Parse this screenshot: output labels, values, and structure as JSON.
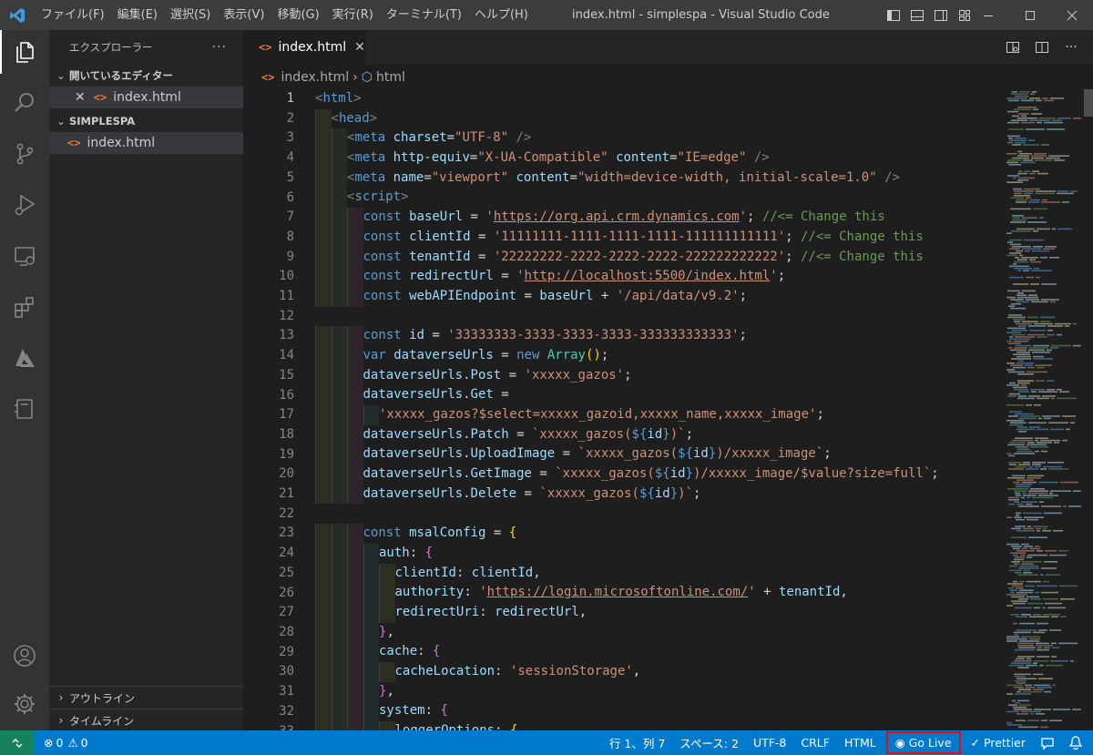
{
  "titlebar": {
    "menus": [
      "ファイル(F)",
      "編集(E)",
      "選択(S)",
      "表示(V)",
      "移動(G)",
      "実行(R)",
      "ターミナル(T)",
      "ヘルプ(H)"
    ],
    "title": "index.html - simplespa - Visual Studio Code"
  },
  "sidebar": {
    "header": "エクスプローラー",
    "more": "···",
    "open_editors_label": "開いているエディター",
    "open_editors": [
      {
        "name": "index.html"
      }
    ],
    "folder_label": "SIMPLESPA",
    "files": [
      {
        "name": "index.html"
      }
    ],
    "outline_label": "アウトライン",
    "timeline_label": "タイムライン"
  },
  "editor": {
    "tab": {
      "label": "index.html"
    },
    "breadcrumb": [
      "index.html",
      "html"
    ],
    "lines": [
      {
        "n": "1",
        "i": "",
        "t": [
          [
            "br",
            "<"
          ],
          [
            "tg",
            "html"
          ],
          [
            "br",
            ">"
          ]
        ]
      },
      {
        "n": "2",
        "i": "y",
        "t": [
          [
            "br",
            "<"
          ],
          [
            "tg",
            "head"
          ],
          [
            "br",
            ">"
          ]
        ]
      },
      {
        "n": "3",
        "i": "yg",
        "t": [
          [
            "br",
            "<"
          ],
          [
            "tg",
            "meta"
          ],
          [
            "pl",
            " "
          ],
          [
            "at",
            "charset"
          ],
          [
            "pl",
            "="
          ],
          [
            "st",
            "\"UTF-8\""
          ],
          [
            "pl",
            " "
          ],
          [
            "br",
            "/>"
          ]
        ]
      },
      {
        "n": "4",
        "i": "yg",
        "t": [
          [
            "br",
            "<"
          ],
          [
            "tg",
            "meta"
          ],
          [
            "pl",
            " "
          ],
          [
            "at",
            "http-equiv"
          ],
          [
            "pl",
            "="
          ],
          [
            "st",
            "\"X-UA-Compatible\""
          ],
          [
            "pl",
            " "
          ],
          [
            "at",
            "content"
          ],
          [
            "pl",
            "="
          ],
          [
            "st",
            "\"IE=edge\""
          ],
          [
            "pl",
            " "
          ],
          [
            "br",
            "/>"
          ]
        ]
      },
      {
        "n": "5",
        "i": "yg",
        "t": [
          [
            "br",
            "<"
          ],
          [
            "tg",
            "meta"
          ],
          [
            "pl",
            " "
          ],
          [
            "at",
            "name"
          ],
          [
            "pl",
            "="
          ],
          [
            "st",
            "\"viewport\""
          ],
          [
            "pl",
            " "
          ],
          [
            "at",
            "content"
          ],
          [
            "pl",
            "="
          ],
          [
            "st",
            "\"width=device-width, initial-scale=1.0\""
          ],
          [
            "pl",
            " "
          ],
          [
            "br",
            "/>"
          ]
        ]
      },
      {
        "n": "6",
        "i": "yg",
        "t": [
          [
            "br",
            "<"
          ],
          [
            "tg",
            "script"
          ],
          [
            "br",
            ">"
          ]
        ]
      },
      {
        "n": "7",
        "i": "ygm",
        "t": [
          [
            "kw",
            "const"
          ],
          [
            "pl",
            " "
          ],
          [
            "vr",
            "baseUrl"
          ],
          [
            "pl",
            " = "
          ],
          [
            "st",
            "'"
          ],
          [
            "stu",
            "https://org.api.crm.dynamics.com"
          ],
          [
            "st",
            "'"
          ],
          [
            "pl",
            "; "
          ],
          [
            "cm",
            "//<= Change this"
          ]
        ]
      },
      {
        "n": "8",
        "i": "ygm",
        "t": [
          [
            "kw",
            "const"
          ],
          [
            "pl",
            " "
          ],
          [
            "vr",
            "clientId"
          ],
          [
            "pl",
            " = "
          ],
          [
            "st",
            "'11111111-1111-1111-1111-111111111111'"
          ],
          [
            "pl",
            "; "
          ],
          [
            "cm",
            "//<= Change this"
          ]
        ]
      },
      {
        "n": "9",
        "i": "ygm",
        "t": [
          [
            "kw",
            "const"
          ],
          [
            "pl",
            " "
          ],
          [
            "vr",
            "tenantId"
          ],
          [
            "pl",
            " = "
          ],
          [
            "st",
            "'22222222-2222-2222-2222-222222222222'"
          ],
          [
            "pl",
            "; "
          ],
          [
            "cm",
            "//<= Change this"
          ]
        ]
      },
      {
        "n": "10",
        "i": "ygm",
        "t": [
          [
            "kw",
            "const"
          ],
          [
            "pl",
            " "
          ],
          [
            "vr",
            "redirectUrl"
          ],
          [
            "pl",
            " = "
          ],
          [
            "st",
            "'"
          ],
          [
            "stu",
            "http://localhost:5500/index.html"
          ],
          [
            "st",
            "'"
          ],
          [
            "pl",
            ";"
          ]
        ]
      },
      {
        "n": "11",
        "i": "ygm",
        "t": [
          [
            "kw",
            "const"
          ],
          [
            "pl",
            " "
          ],
          [
            "vr",
            "webAPIEndpoint"
          ],
          [
            "pl",
            " = "
          ],
          [
            "vr",
            "baseUrl"
          ],
          [
            "pl",
            " + "
          ],
          [
            "st",
            "'/api/data/v9.2'"
          ],
          [
            "pl",
            ";"
          ]
        ]
      },
      {
        "n": "12",
        "i": "",
        "t": []
      },
      {
        "n": "13",
        "i": "ygm",
        "t": [
          [
            "kw",
            "const"
          ],
          [
            "pl",
            " "
          ],
          [
            "vr",
            "id"
          ],
          [
            "pl",
            " = "
          ],
          [
            "st",
            "'33333333-3333-3333-3333-333333333333'"
          ],
          [
            "pl",
            ";"
          ]
        ]
      },
      {
        "n": "14",
        "i": "ygm",
        "t": [
          [
            "kw",
            "var"
          ],
          [
            "pl",
            " "
          ],
          [
            "vr",
            "dataverseUrls"
          ],
          [
            "pl",
            " = "
          ],
          [
            "kw",
            "new"
          ],
          [
            "pl",
            " "
          ],
          [
            "cl",
            "Array"
          ],
          [
            "b1",
            "()"
          ],
          [
            "pl",
            ";"
          ]
        ]
      },
      {
        "n": "15",
        "i": "ygm",
        "t": [
          [
            "vr",
            "dataverseUrls"
          ],
          [
            "pl",
            "."
          ],
          [
            "vr",
            "Post"
          ],
          [
            "pl",
            " = "
          ],
          [
            "st",
            "'xxxxx_gazos'"
          ],
          [
            "pl",
            ";"
          ]
        ]
      },
      {
        "n": "16",
        "i": "ygm",
        "t": [
          [
            "vr",
            "dataverseUrls"
          ],
          [
            "pl",
            "."
          ],
          [
            "vr",
            "Get"
          ],
          [
            "pl",
            " ="
          ]
        ]
      },
      {
        "n": "17",
        "i": "ygmc",
        "t": [
          [
            "st",
            "'xxxxx_gazos?$select=xxxxx_gazoid,xxxxx_name,xxxxx_image'"
          ],
          [
            "pl",
            ";"
          ]
        ]
      },
      {
        "n": "18",
        "i": "ygm",
        "t": [
          [
            "vr",
            "dataverseUrls"
          ],
          [
            "pl",
            "."
          ],
          [
            "vr",
            "Patch"
          ],
          [
            "pl",
            " = "
          ],
          [
            "st",
            "`xxxxx_gazos("
          ],
          [
            "tp",
            "${"
          ],
          [
            "vr",
            "id"
          ],
          [
            "tp",
            "}"
          ],
          [
            "st",
            ")`"
          ],
          [
            "pl",
            ";"
          ]
        ]
      },
      {
        "n": "19",
        "i": "ygm",
        "t": [
          [
            "vr",
            "dataverseUrls"
          ],
          [
            "pl",
            "."
          ],
          [
            "vr",
            "UploadImage"
          ],
          [
            "pl",
            " = "
          ],
          [
            "st",
            "`xxxxx_gazos("
          ],
          [
            "tp",
            "${"
          ],
          [
            "vr",
            "id"
          ],
          [
            "tp",
            "}"
          ],
          [
            "st",
            ")/xxxxx_image`"
          ],
          [
            "pl",
            ";"
          ]
        ]
      },
      {
        "n": "20",
        "i": "ygm",
        "t": [
          [
            "vr",
            "dataverseUrls"
          ],
          [
            "pl",
            "."
          ],
          [
            "vr",
            "GetImage"
          ],
          [
            "pl",
            " = "
          ],
          [
            "st",
            "`xxxxx_gazos("
          ],
          [
            "tp",
            "${"
          ],
          [
            "vr",
            "id"
          ],
          [
            "tp",
            "}"
          ],
          [
            "st",
            ")/xxxxx_image/$value?size=full`"
          ],
          [
            "pl",
            ";"
          ]
        ]
      },
      {
        "n": "21",
        "i": "ygm",
        "t": [
          [
            "vr",
            "dataverseUrls"
          ],
          [
            "pl",
            "."
          ],
          [
            "vr",
            "Delete"
          ],
          [
            "pl",
            " = "
          ],
          [
            "st",
            "`xxxxx_gazos("
          ],
          [
            "tp",
            "${"
          ],
          [
            "vr",
            "id"
          ],
          [
            "tp",
            "}"
          ],
          [
            "st",
            ")`"
          ],
          [
            "pl",
            ";"
          ]
        ]
      },
      {
        "n": "22",
        "i": "",
        "t": []
      },
      {
        "n": "23",
        "i": "ygm",
        "t": [
          [
            "kw",
            "const"
          ],
          [
            "pl",
            " "
          ],
          [
            "vr",
            "msalConfig"
          ],
          [
            "pl",
            " = "
          ],
          [
            "b1",
            "{"
          ]
        ]
      },
      {
        "n": "24",
        "i": "ygmc",
        "t": [
          [
            "vr",
            "auth"
          ],
          [
            "pl",
            ": "
          ],
          [
            "b2",
            "{"
          ]
        ]
      },
      {
        "n": "25",
        "i": "ygmcy",
        "t": [
          [
            "vr",
            "clientId"
          ],
          [
            "pl",
            ": "
          ],
          [
            "vr",
            "clientId"
          ],
          [
            "pl",
            ","
          ]
        ]
      },
      {
        "n": "26",
        "i": "ygmcy",
        "t": [
          [
            "vr",
            "authority"
          ],
          [
            "pl",
            ": "
          ],
          [
            "st",
            "'"
          ],
          [
            "stu",
            "https://login.microsoftonline.com/"
          ],
          [
            "st",
            "'"
          ],
          [
            "pl",
            " + "
          ],
          [
            "vr",
            "tenantId"
          ],
          [
            "pl",
            ","
          ]
        ]
      },
      {
        "n": "27",
        "i": "ygmcy",
        "t": [
          [
            "vr",
            "redirectUri"
          ],
          [
            "pl",
            ": "
          ],
          [
            "vr",
            "redirectUrl"
          ],
          [
            "pl",
            ","
          ]
        ]
      },
      {
        "n": "28",
        "i": "ygmc",
        "t": [
          [
            "b2",
            "}"
          ],
          [
            "pl",
            ","
          ]
        ]
      },
      {
        "n": "29",
        "i": "ygmc",
        "t": [
          [
            "vr",
            "cache"
          ],
          [
            "pl",
            ": "
          ],
          [
            "b2",
            "{"
          ]
        ]
      },
      {
        "n": "30",
        "i": "ygmcy",
        "t": [
          [
            "vr",
            "cacheLocation"
          ],
          [
            "pl",
            ": "
          ],
          [
            "st",
            "'sessionStorage'"
          ],
          [
            "pl",
            ","
          ]
        ]
      },
      {
        "n": "31",
        "i": "ygmc",
        "t": [
          [
            "b2",
            "}"
          ],
          [
            "pl",
            ","
          ]
        ]
      },
      {
        "n": "32",
        "i": "ygmc",
        "t": [
          [
            "vr",
            "system"
          ],
          [
            "pl",
            ": "
          ],
          [
            "b2",
            "{"
          ]
        ]
      },
      {
        "n": "33",
        "i": "ygmcy",
        "t": [
          [
            "vr",
            "loggerOptions"
          ],
          [
            "pl",
            ": "
          ],
          [
            "b1",
            "{"
          ]
        ]
      }
    ]
  },
  "statusbar": {
    "errors": "0",
    "warnings": "0",
    "position": "行 1、列 7",
    "spaces": "スペース: 2",
    "encoding": "UTF-8",
    "eol": "CRLF",
    "language": "HTML",
    "golive": "Go Live",
    "prettier": "Prettier"
  },
  "colors": {
    "accent": "#007acc",
    "remote": "#16825d",
    "highlight_box": "#e01010"
  }
}
